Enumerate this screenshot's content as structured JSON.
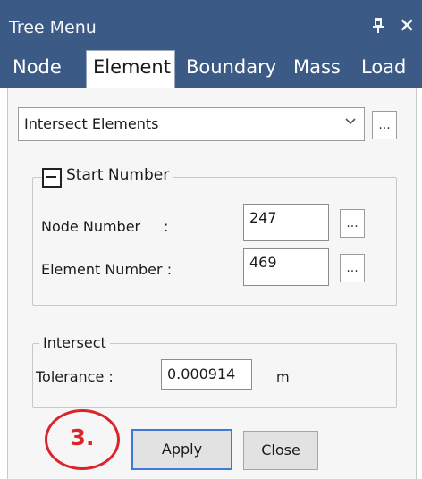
{
  "window": {
    "title": "Tree Menu",
    "pin_glyph": "ᵖ",
    "close_glyph": "×"
  },
  "tabs": [
    {
      "label": "Node"
    },
    {
      "label": "Element",
      "active": true
    },
    {
      "label": "Boundary"
    },
    {
      "label": "Mass"
    },
    {
      "label": "Load"
    }
  ],
  "function_select": {
    "value": "Intersect Elements",
    "more_label": "..."
  },
  "start_number": {
    "title": "Start Number",
    "node_label": "Node Number",
    "node_colon": ":",
    "node_value": "247",
    "element_label": "Element Number :",
    "element_value": "469",
    "more_label": "..."
  },
  "intersect": {
    "title": "Intersect",
    "tolerance_label": "Tolerance :",
    "tolerance_value": "0.000914",
    "unit": "m"
  },
  "buttons": {
    "apply": "Apply",
    "close": "Close"
  },
  "annotation": {
    "callout": "3.",
    "color": "#d8262a"
  },
  "colors": {
    "titlebar": "#3b5a86",
    "apply_focus": "#3d7ad6"
  }
}
